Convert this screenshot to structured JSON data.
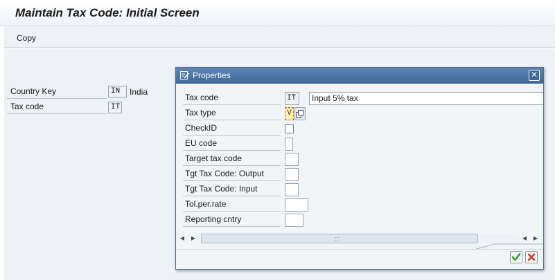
{
  "window": {
    "title": "Maintain Tax Code: Initial Screen"
  },
  "toolbar": {
    "copy_label": "Copy"
  },
  "initial_screen": {
    "country_key": {
      "label": "Country Key",
      "value": "IN",
      "description": "India"
    },
    "tax_code": {
      "label": "Tax code",
      "value": "IT"
    }
  },
  "dialog": {
    "title": "Properties",
    "title_icon": "edit-properties-icon",
    "close_icon": "close-icon",
    "fields": {
      "tax_code": {
        "label": "Tax code",
        "value": "IT",
        "description": "Input 5% tax"
      },
      "tax_type": {
        "label": "Tax type",
        "value": "V"
      },
      "check_id": {
        "label": "CheckID",
        "checked": false
      },
      "eu_code": {
        "label": "EU code",
        "value": ""
      },
      "target_tax_code": {
        "label": "Target tax code",
        "value": ""
      },
      "tgt_tax_code_output": {
        "label": "Tgt Tax Code: Output",
        "value": ""
      },
      "tgt_tax_code_input": {
        "label": "Tgt Tax Code: Input",
        "value": ""
      },
      "tol_per_rate": {
        "label": "Tol.per.rate",
        "value": ""
      },
      "reporting_cntry": {
        "label": "Reporting cntry",
        "value": ""
      }
    },
    "scroll_grip": ":::",
    "buttons": {
      "ok_icon": "checkmark-icon",
      "cancel_icon": "cancel-x-icon"
    }
  },
  "colors": {
    "dialog_title_bar": "#3b6797",
    "ok_green": "#2e9a2e",
    "cancel_red": "#d03a2a",
    "highlight_field": "#fff3a8"
  }
}
